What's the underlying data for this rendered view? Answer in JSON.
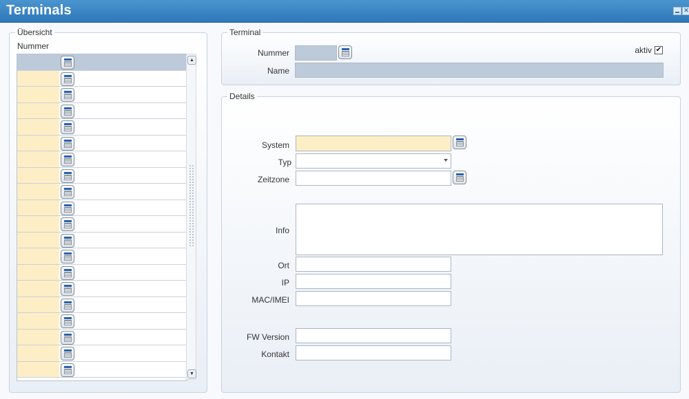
{
  "window": {
    "title": "Terminals",
    "minimize_glyph": "",
    "close_glyph": "✕"
  },
  "overview": {
    "legend": "Übersicht",
    "column_header": "Nummer",
    "rows": [
      {
        "nummer": "",
        "selected": true
      },
      {
        "nummer": ""
      },
      {
        "nummer": ""
      },
      {
        "nummer": ""
      },
      {
        "nummer": ""
      },
      {
        "nummer": ""
      },
      {
        "nummer": ""
      },
      {
        "nummer": ""
      },
      {
        "nummer": ""
      },
      {
        "nummer": ""
      },
      {
        "nummer": ""
      },
      {
        "nummer": ""
      },
      {
        "nummer": ""
      },
      {
        "nummer": ""
      },
      {
        "nummer": ""
      },
      {
        "nummer": ""
      },
      {
        "nummer": ""
      },
      {
        "nummer": ""
      },
      {
        "nummer": ""
      },
      {
        "nummer": ""
      }
    ]
  },
  "terminal": {
    "legend": "Terminal",
    "nummer_label": "Nummer",
    "nummer_value": "",
    "name_label": "Name",
    "name_value": "",
    "aktiv_label": "aktiv",
    "aktiv_checked": true,
    "aktiv_glyph": "✔"
  },
  "details": {
    "legend": "Details",
    "system_label": "System",
    "system_value": "",
    "typ_label": "Typ",
    "typ_value": "",
    "zeitzone_label": "Zeitzone",
    "zeitzone_value": "",
    "info_label": "Info",
    "info_value": "",
    "ort_label": "Ort",
    "ort_value": "",
    "ip_label": "IP",
    "ip_value": "",
    "mac_label": "MAC/IMEI",
    "mac_value": "",
    "fw_label": "FW Version",
    "fw_value": "",
    "kontakt_label": "Kontakt",
    "kontakt_value": ""
  },
  "icons": {
    "calendar": "calendar-icon",
    "scroll_up": "▲",
    "scroll_down": "▼"
  },
  "colors": {
    "titlebar": "#3a86c5",
    "selected_row": "#bccada",
    "required_field": "#fdeec5",
    "readonly_field": "#bccada"
  }
}
